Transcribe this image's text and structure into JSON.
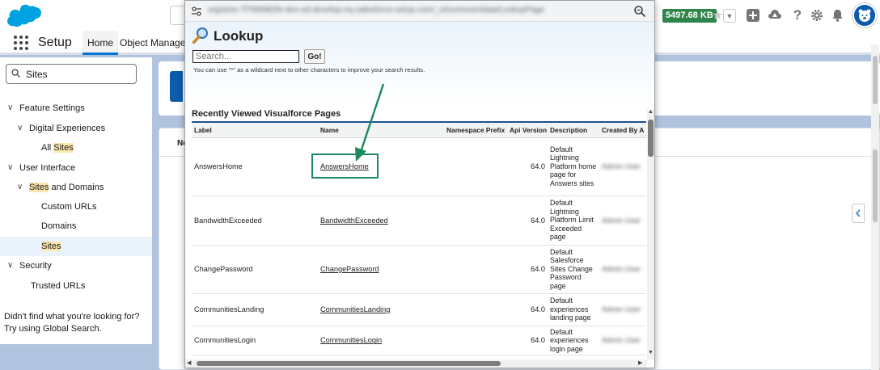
{
  "header": {
    "storage": "5497.68 KB"
  },
  "nav": {
    "app_name": "Setup",
    "tabs": [
      "Home",
      "Object Manager"
    ]
  },
  "sidebar": {
    "quick_find_value": "Sites",
    "tree": [
      {
        "label": "Feature Settings",
        "level": 0,
        "expanded": true
      },
      {
        "label": "Digital Experiences",
        "level": 1,
        "expanded": true
      },
      {
        "label_pre": "All ",
        "label_hl": "Sites",
        "label_post": "",
        "level": 2
      },
      {
        "label": "User Interface",
        "level": 0,
        "expanded": true
      },
      {
        "label_pre": "",
        "label_hl": "Sites",
        "label_post": " and Domains",
        "level": 1,
        "expanded": true
      },
      {
        "label": "Custom URLs",
        "level": 2
      },
      {
        "label": "Domains",
        "level": 2
      },
      {
        "label_pre": "",
        "label_hl": "Sites",
        "label_post": "",
        "level": 2,
        "selected": true
      },
      {
        "label": "Security",
        "level": 0,
        "expanded": true
      },
      {
        "label": "Trusted URLs",
        "level": 1
      }
    ],
    "help_text": "Didn't find what you're looking for? Try using Global Search."
  },
  "main": {
    "card_header_partial": "Ne"
  },
  "popup": {
    "url": "orgstore-7f7fd9982fe-dev-ed.develop.my.salesforce-setup.com/_ui/common/data/LookupPage",
    "title": "Lookup",
    "search_placeholder": "Search...",
    "go_label": "Go!",
    "hint": "You can use \"*\" as a wildcard next to other characters to improve your search results.",
    "section_title": "Recently Viewed Visualforce Pages",
    "columns": [
      "Label",
      "Name",
      "Namespace Prefix",
      "Api Version",
      "Description",
      "Created By A"
    ],
    "rows": [
      {
        "label": "AnswersHome",
        "name": "AnswersHome",
        "namespace": "",
        "api": "64.0",
        "desc": "Default Lightning Platform home page for Answers sites",
        "created_by": "Admin User"
      },
      {
        "label": "BandwidthExceeded",
        "name": "BandwidthExceeded",
        "namespace": "",
        "api": "64.0",
        "desc": "Default Lightning Platform Limit Exceeded page",
        "created_by": "Admin User"
      },
      {
        "label": "ChangePassword",
        "name": "ChangePassword",
        "namespace": "",
        "api": "64.0",
        "desc": "Default Salesforce Sites Change Password page",
        "created_by": "Admin User"
      },
      {
        "label": "CommunitiesLanding",
        "name": "CommunitiesLanding",
        "namespace": "",
        "api": "64.0",
        "desc": "Default experiences landing page",
        "created_by": "Admin User"
      },
      {
        "label": "CommunitiesLogin",
        "name": "CommunitiesLogin",
        "namespace": "",
        "api": "64.0",
        "desc": "Default experiences login page",
        "created_by": "Admin User"
      }
    ]
  },
  "colors": {
    "annotation": "#1c8a5c",
    "sf_blue": "#00a1e0",
    "section_rule": "#1b5297",
    "storage_badge": "#2e844a"
  },
  "icons": {
    "logo": "salesforce-cloud-logo",
    "tune": "site-settings-icon",
    "zoom": "zoom-magnifier-icon",
    "lookup": "magnifier-icon"
  }
}
